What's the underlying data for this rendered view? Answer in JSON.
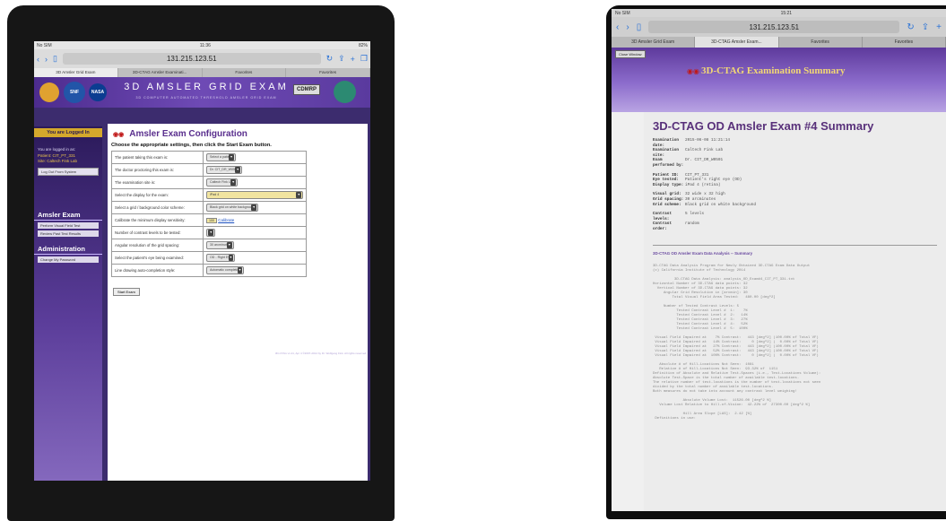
{
  "left_ipad": {
    "status_bar": {
      "carrier": "No SIM",
      "time": "11:36",
      "battery": "82%"
    },
    "browser": {
      "url": "131.215.123.51",
      "tabs": [
        "3D Amsler Grid Exam",
        "3D-CTAG Amsler Examinati...",
        "Favorites",
        "Favorites"
      ]
    },
    "banner": {
      "title": "3D AMSLER GRID EXAM",
      "subtitle": "3D COMPUTER AUTOMATED THRESHOLD AMSLER GRID EXAM",
      "badge": "CDMRP",
      "logos": [
        "SNF",
        "NASA"
      ]
    },
    "sidebar": {
      "logged_in_label": "You are Logged In",
      "user_lines": [
        "You are logged in as:",
        "Patient: CIT_PT_331",
        "Site: Caltech Fink Lab"
      ],
      "logout_button": "Log Out From System",
      "section1": "Amsler Exam",
      "section1_items": [
        "Perform Visual Field Test",
        "Review Past Test Results"
      ],
      "section2": "Administration",
      "section2_items": [
        "Change My Password"
      ]
    },
    "main": {
      "heading": "Amsler Exam Configuration",
      "instructions": "Choose the appropriate settings, then click the Start Exam button.",
      "rows": [
        {
          "question": "The patient taking this exam is:",
          "value": "Select a patient"
        },
        {
          "question": "The doctor proctoring this exam is:",
          "value": "Dr. CIT_DR_W0501"
        },
        {
          "question": "The examination site is:",
          "value": "Caltech Fink Lab"
        },
        {
          "question": "Select the display for the exam:",
          "value": "iPad 4"
        },
        {
          "question": "Select a grid / background color scheme:",
          "value": "Black grid on white background"
        },
        {
          "question": "Calibrate the minimum display sensitivity:",
          "value": "100",
          "link": "Calibrate"
        },
        {
          "question": "Number of contrast levels to be tested:",
          "value": "5"
        },
        {
          "question": "Angular resolution of the grid spacing:",
          "value": "30 arcminutes"
        },
        {
          "question": "Select the patient's eye being examined:",
          "value": "OD - Right Eye"
        },
        {
          "question": "Line drawing auto-completion style:",
          "value": "Automatic completion"
        }
      ],
      "start_button": "Start Exam",
      "footer": "3D-CTAG v1.21, Apr 4 ©2007-2014 by Dr. Wolfgang Fink. All rights reserved."
    }
  },
  "right_ipad": {
    "status_bar": {
      "carrier": "No SIM",
      "time": "15:21"
    },
    "browser": {
      "url": "131.215.123.51",
      "tabs": [
        "3D Amsler Grid Exam",
        "3D-CTAG Amsler Exam...",
        "Favorites",
        "Favorites"
      ]
    },
    "banner": {
      "close_button": "Close Window",
      "title": "3D-CTAG Examination Summary"
    },
    "document": {
      "heading": "3D-CTAG OD Amsler Exam #4 Summary",
      "block1": [
        {
          "k": "Examination date:",
          "v": "2015-06-08 11:21:14"
        },
        {
          "k": "Examination site:",
          "v": "Caltech Fink Lab"
        },
        {
          "k": "Exam performed by:",
          "v": "Dr. CIT_DR_W0501"
        }
      ],
      "block2": [
        {
          "k": "Patient ID:",
          "v": "CIT_PT_331"
        },
        {
          "k": "Eye tested:",
          "v": "Patient's right eye (OD)"
        },
        {
          "k": "Display type:",
          "v": "iPad 4 (retina)"
        }
      ],
      "block3": [
        {
          "k": "Visual grid:",
          "v": "32 wide x 32 high"
        },
        {
          "k": "Grid spacing:",
          "v": "30 arcminutes"
        },
        {
          "k": "Grid scheme:",
          "v": "Black grid on white background"
        }
      ],
      "block4": [
        {
          "k": "Contrast levels:",
          "v": "5 levels"
        },
        {
          "k": "Contrast order:",
          "v": "random"
        }
      ],
      "analysis_link": "3D-CTAG OD Amsler Exam Data Analysis -- Summary",
      "analysis_text": "3D-CTAG Data Analysis Program for Newly Obtained 3D-CTAG Exam Data Output\n(c) California Institute of Technology 2014\n\n          3D-CTAG Data Analysis: analysis_OD_Exam#4_CIT_PT_331.txt\nHorizontal Number of 3D-CTAG data points: 32\n  Vertical Number of 3D-CTAG data points: 32\n     Angular Grid Resolution in [arcmin]: 30\n         Total Visual Field Area Tested:   480.00 [deg^2]\n\n     Number of Tested Contrast Levels: 5\n           Tested Contrast Level #  1:    7%\n           Tested Contrast Level #  2:   14%\n           Tested Contrast Level #  3:   27%\n           Tested Contrast Level #  4:   52%\n           Tested Contrast Level #  5:  100%\n\n Visual Field Impaired at    7% Contrast:   443 [deg^2] (100.00% of Total VF)\n Visual Field Impaired at   14% Contrast:     0 [deg^2] (  0.00% of Total VF)\n Visual Field Impaired at   27% Contrast:   443 [deg^2] (100.00% of Total VF)\n Visual Field Impaired at   52% Contrast:   443 [deg^2] (100.00% of Total VF)\n Visual Field Impaired at  100% Contrast:     0 [deg^2] (  0.00% of Total VF)\n\n   Absolute # of Hill-Locations Not Seen:  1081\n   Relative # of Hill-Locations Not Seen:  93.32% of  1151\nDefinition of Absolute and Relative Test-Spaces (i.e., Test-Locations Volume):\nAbsolute Test-Space is the total number of available test-locations.\nThe relative number of test-locations is the number of test-locations not seen\ndivided by the total number of available test-locations.\nBoth measures do not take into account any contrast level weighing!\n\n              Absolute Volume Lost:  11526.00 [deg^2 %]\n   Volume Lost Relative to Hill-of-Vision:  42.22% of  27300.00 [deg^2 %]\n\n              Hill Area Slope [LAS]:  2.42 [%]\n Definitions in use:"
    }
  }
}
